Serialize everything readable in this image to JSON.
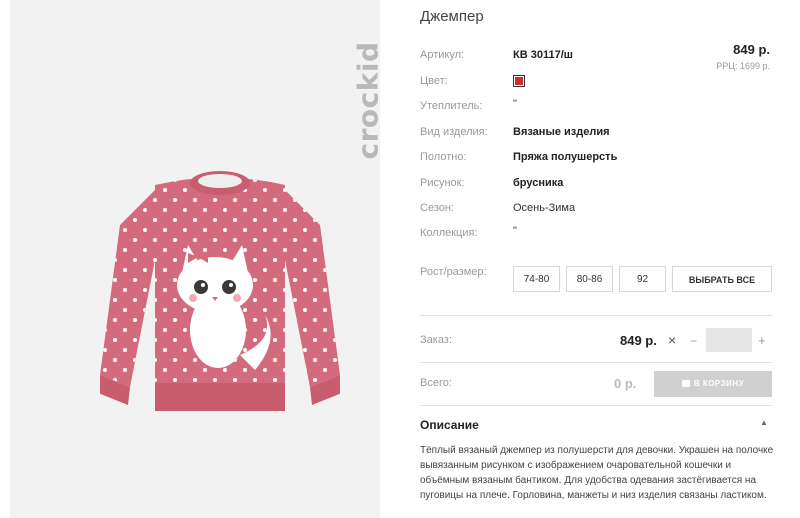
{
  "product": {
    "title": "Джемпер",
    "brand": "crockid",
    "price": "849 р.",
    "rrp": "РРЦ: 1699 р."
  },
  "attributes": [
    {
      "label": "Артикул:",
      "value": "КВ 30117/ш"
    },
    {
      "label": "Цвет:",
      "value": "",
      "color": "#c9302c"
    },
    {
      "label": "Утеплитель:",
      "value": "\""
    },
    {
      "label": "Вид изделия:",
      "value": "Вязаные изделия"
    },
    {
      "label": "Полотно:",
      "value": "Пряжа полушерсть"
    },
    {
      "label": "Рисунок:",
      "value": "брусника"
    },
    {
      "label": "Сезон:",
      "value": "Осень-Зима"
    },
    {
      "label": "Коллекция:",
      "value": "\""
    }
  ],
  "sizes": {
    "label": "Рост/размер:",
    "options": [
      "74-80",
      "80-86",
      "92"
    ],
    "select_all": "ВЫБРАТЬ ВСЕ"
  },
  "order": {
    "label": "Заказ:",
    "price": "849 р.",
    "times": "×",
    "minus": "−",
    "plus": "+",
    "quantity": ""
  },
  "total": {
    "label": "Всего:",
    "value": "0 р.",
    "cart_button": "В КОРЗИНУ"
  },
  "description": {
    "title": "Описание",
    "text": "Тёплый вязаный джемпер из полушерсти для девочки. Украшен на полочке вывязанным рисунком с изображением очаровательной кошечки и объёмным вязаным бантиком. Для удобства одевания застёгивается на пуговицы на плече. Горловина, манжеты и низ изделия связаны ластиком."
  },
  "colors": {
    "sweater": "#d36b7c",
    "accent_disabled": "#d0d0d0"
  }
}
